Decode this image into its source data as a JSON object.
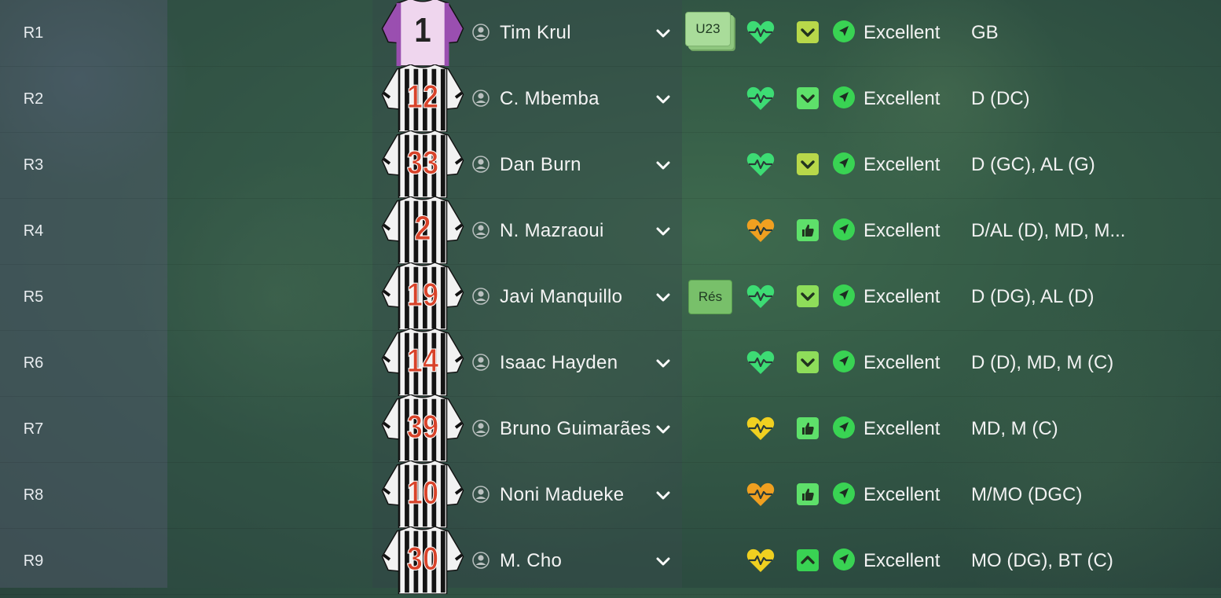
{
  "colors": {
    "accent_green": "#39d353",
    "heart_green": "#3ddc74",
    "heart_orange": "#f0a020",
    "heart_yellow": "#f0d020",
    "stripe_black": "#141414",
    "shirt_number_red": "#d8432a",
    "gk_purple": "#9a4fb0"
  },
  "rows": [
    {
      "label": "R1",
      "number": "1",
      "name": "Tim Krul",
      "badge": "U23",
      "badge_type": "u23",
      "heart": "green",
      "morale": "chevron-down",
      "morale_color": "#b8d84a",
      "condition": "Excellent",
      "position": "GB",
      "kit": "goalkeeper"
    },
    {
      "label": "R2",
      "number": "12",
      "name": "C. Mbemba",
      "badge": "",
      "badge_type": "",
      "heart": "green",
      "morale": "chevron-down",
      "morale_color": "#5ee06a",
      "condition": "Excellent",
      "position": "D (DC)",
      "kit": "outfield"
    },
    {
      "label": "R3",
      "number": "33",
      "name": "Dan Burn",
      "badge": "",
      "badge_type": "",
      "heart": "green",
      "morale": "chevron-down",
      "morale_color": "#b8d84a",
      "condition": "Excellent",
      "position": "D (GC), AL (G)",
      "kit": "outfield"
    },
    {
      "label": "R4",
      "number": "2",
      "name": "N. Mazraoui",
      "badge": "",
      "badge_type": "",
      "heart": "orange",
      "morale": "thumbs-up",
      "morale_color": "#5ee06a",
      "condition": "Excellent",
      "position": "D/AL (D), MD, M...",
      "kit": "outfield"
    },
    {
      "label": "R5",
      "number": "19",
      "name": "Javi Manquillo",
      "badge": "Rés",
      "badge_type": "res",
      "heart": "green",
      "morale": "chevron-down",
      "morale_color": "#8edd5a",
      "condition": "Excellent",
      "position": "D (DG), AL (D)",
      "kit": "outfield"
    },
    {
      "label": "R6",
      "number": "14",
      "name": "Isaac Hayden",
      "badge": "",
      "badge_type": "",
      "heart": "green",
      "morale": "chevron-down",
      "morale_color": "#8edd5a",
      "condition": "Excellent",
      "position": "D (D), MD, M (C)",
      "kit": "outfield"
    },
    {
      "label": "R7",
      "number": "39",
      "name": "Bruno Guimarães",
      "badge": "",
      "badge_type": "",
      "heart": "yellow",
      "morale": "thumbs-up",
      "morale_color": "#5ee06a",
      "condition": "Excellent",
      "position": "MD, M (C)",
      "kit": "outfield"
    },
    {
      "label": "R8",
      "number": "10",
      "name": "Noni Madueke",
      "badge": "",
      "badge_type": "",
      "heart": "orange",
      "morale": "thumbs-up",
      "morale_color": "#5ee06a",
      "condition": "Excellent",
      "position": "M/MO (DGC)",
      "kit": "outfield"
    },
    {
      "label": "R9",
      "number": "30",
      "name": "M. Cho",
      "badge": "",
      "badge_type": "",
      "heart": "yellow",
      "morale": "chevron-up",
      "morale_color": "#39d353",
      "condition": "Excellent",
      "position": "MO (DG), BT (C)",
      "kit": "outfield"
    }
  ]
}
